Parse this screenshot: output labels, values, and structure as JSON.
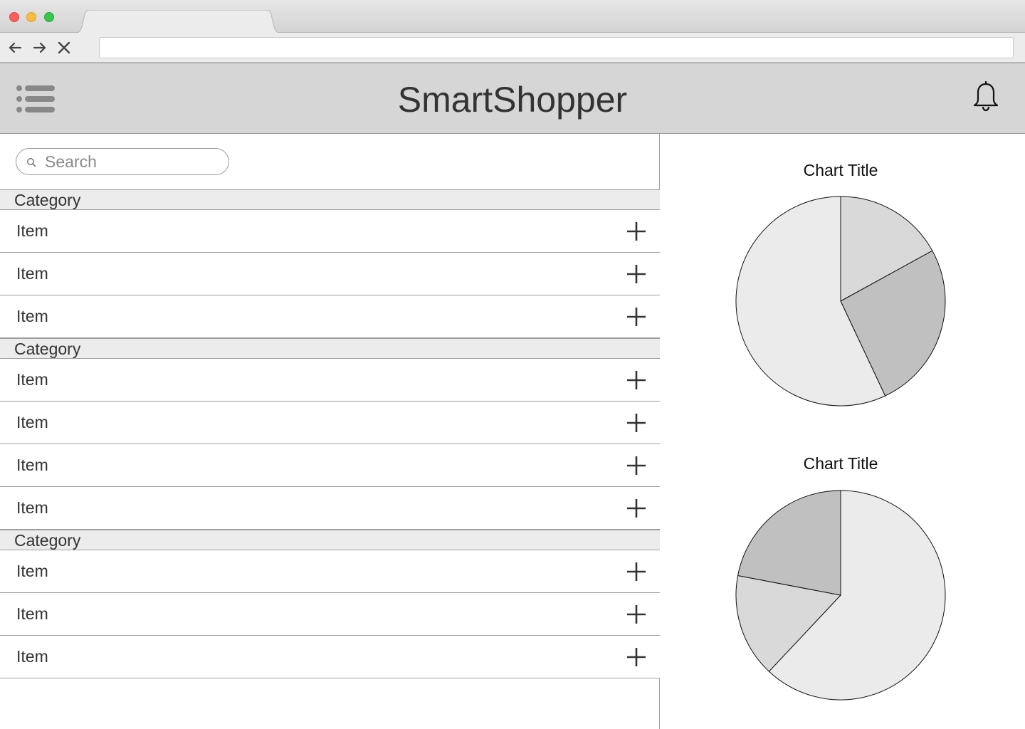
{
  "browser": {
    "tab_title": "",
    "address": ""
  },
  "app": {
    "title": "SmartShopper"
  },
  "search": {
    "placeholder": "Search",
    "value": ""
  },
  "groups": [
    {
      "category": "Category",
      "items": [
        "Item",
        "Item",
        "Item"
      ]
    },
    {
      "category": "Category",
      "items": [
        "Item",
        "Item",
        "Item",
        "Item"
      ]
    },
    {
      "category": "Category",
      "items": [
        "Item",
        "Item",
        "Item"
      ]
    }
  ],
  "icons": {
    "menu": "list-menu-icon",
    "notifications": "bell-icon",
    "search": "search-icon",
    "add": "plus-icon"
  },
  "chart_data": [
    {
      "type": "pie",
      "title": "Chart Title",
      "start_angle_deg": 0,
      "slices": [
        {
          "value": 17,
          "color": "#d9d9d9"
        },
        {
          "value": 26,
          "color": "#c0c0c0"
        },
        {
          "value": 57,
          "color": "#ebebeb"
        }
      ]
    },
    {
      "type": "pie",
      "title": "Chart Title",
      "start_angle_deg": 0,
      "slices": [
        {
          "value": 62,
          "color": "#ebebeb"
        },
        {
          "value": 16,
          "color": "#d9d9d9"
        },
        {
          "value": 22,
          "color": "#c0c0c0"
        }
      ]
    }
  ]
}
